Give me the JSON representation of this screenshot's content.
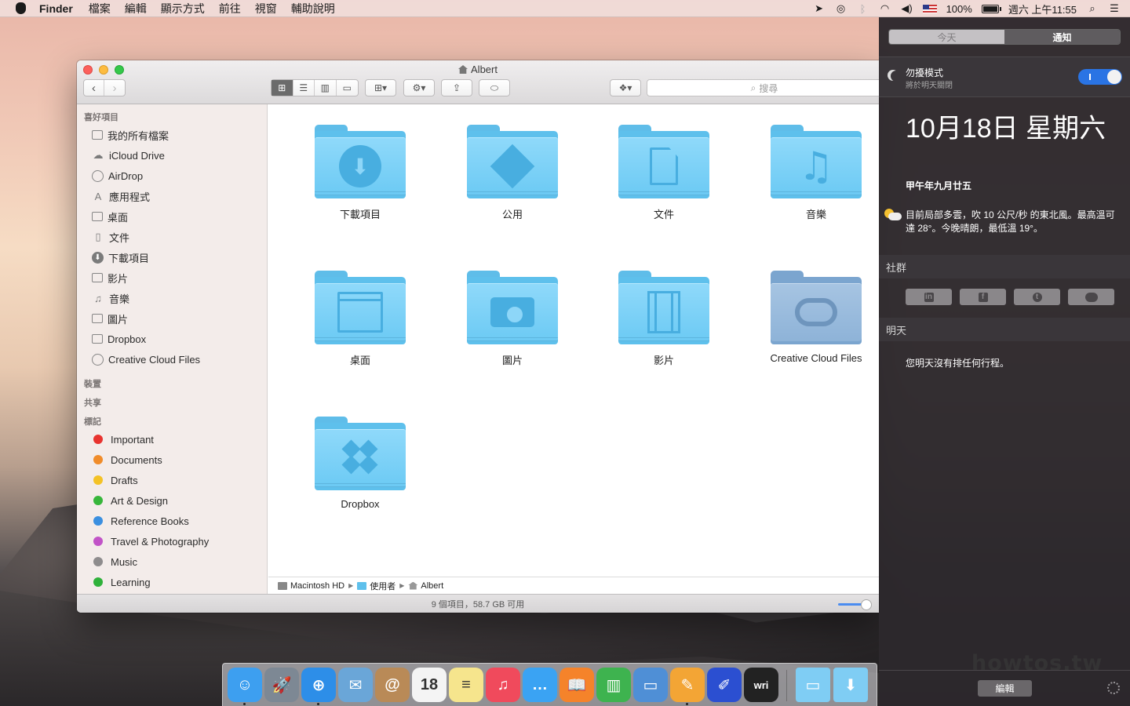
{
  "menubar": {
    "app_name": "Finder",
    "menus": [
      "檔案",
      "編輯",
      "顯示方式",
      "前往",
      "視窗",
      "輔助說明"
    ],
    "battery": "100%",
    "clock": "週六 上午11:55"
  },
  "finder": {
    "title": "Albert",
    "search_placeholder": "搜尋",
    "sidebar": {
      "favorites_header": "喜好項目",
      "favorites": [
        {
          "label": "我的所有檔案",
          "icon": "all-files-icon"
        },
        {
          "label": "iCloud Drive",
          "icon": "cloud-icon"
        },
        {
          "label": "AirDrop",
          "icon": "airdrop-icon"
        },
        {
          "label": "應用程式",
          "icon": "applications-icon"
        },
        {
          "label": "桌面",
          "icon": "desktop-icon"
        },
        {
          "label": "文件",
          "icon": "documents-icon"
        },
        {
          "label": "下載項目",
          "icon": "downloads-icon"
        },
        {
          "label": "影片",
          "icon": "movies-icon"
        },
        {
          "label": "音樂",
          "icon": "music-icon"
        },
        {
          "label": "圖片",
          "icon": "pictures-icon"
        },
        {
          "label": "Dropbox",
          "icon": "folder-icon"
        },
        {
          "label": "Creative Cloud Files",
          "icon": "creative-cloud-icon"
        }
      ],
      "devices_header": "裝置",
      "shared_header": "共享",
      "tags_header": "標記",
      "tags": [
        {
          "label": "Important",
          "color": "#e8332f"
        },
        {
          "label": "Documents",
          "color": "#f08c2a"
        },
        {
          "label": "Drafts",
          "color": "#f4c226"
        },
        {
          "label": "Art & Design",
          "color": "#37b63b"
        },
        {
          "label": "Reference Books",
          "color": "#3a8fe0"
        },
        {
          "label": "Travel & Photography",
          "color": "#c153c7"
        },
        {
          "label": "Music",
          "color": "#8e8c8d"
        },
        {
          "label": "Learning",
          "color": "#2fb13a"
        }
      ]
    },
    "folders": [
      {
        "label": "下載項目",
        "glyph": "download-icon"
      },
      {
        "label": "公用",
        "glyph": "public-icon"
      },
      {
        "label": "文件",
        "glyph": "document-icon"
      },
      {
        "label": "音樂",
        "glyph": "music-note-icon"
      },
      {
        "label": "桌面",
        "glyph": "desktop-window-icon"
      },
      {
        "label": "圖片",
        "glyph": "camera-icon"
      },
      {
        "label": "影片",
        "glyph": "film-icon"
      },
      {
        "label": "Creative Cloud Files",
        "glyph": "creative-cloud-icon"
      },
      {
        "label": "Dropbox",
        "glyph": "dropbox-icon"
      }
    ],
    "path": [
      "Macintosh HD",
      "使用者",
      "Albert"
    ],
    "status": "9 個項目，58.7 GB 可用"
  },
  "notification_center": {
    "tabs": [
      "今天",
      "通知"
    ],
    "active_tab": "今天",
    "dnd_title": "勿擾模式",
    "dnd_subtitle": "將於明天關閉",
    "dnd_enabled": true,
    "date": "10月18日 星期六",
    "lunar": "甲午年九月廿五",
    "weather": "目前局部多雲，吹 10 公尺/秒 的東北風。最高溫可達 28°。今晚晴朗，最低溫 19°。",
    "social_header": "社群",
    "social_buttons": [
      "in",
      "f",
      "t",
      "msg"
    ],
    "tomorrow_header": "明天",
    "tomorrow_text": "您明天沒有排任何行程。",
    "edit_label": "編輯"
  },
  "watermark": "howtos.tw",
  "dock": [
    {
      "name": "finder-dock-icon",
      "color": "#3d9ff0",
      "label": "☺"
    },
    {
      "name": "launchpad-dock-icon",
      "color": "#7d8894",
      "label": "🚀"
    },
    {
      "name": "safari-dock-icon",
      "color": "#2d8ee8",
      "label": "⊕"
    },
    {
      "name": "mail-dock-icon",
      "color": "#6aa6d8",
      "label": "✉"
    },
    {
      "name": "contacts-dock-icon",
      "color": "#b98a57",
      "label": "@"
    },
    {
      "name": "calendar-dock-icon",
      "color": "#f4f4f4",
      "label": "18"
    },
    {
      "name": "notes-dock-icon",
      "color": "#f6e58d",
      "label": "≡"
    },
    {
      "name": "itunes-dock-icon",
      "color": "#f04a5c",
      "label": "♫"
    },
    {
      "name": "messages-dock-icon",
      "color": "#3aa3f3",
      "label": "…"
    },
    {
      "name": "ibooks-dock-icon",
      "color": "#f5832a",
      "label": "📖"
    },
    {
      "name": "numbers-dock-icon",
      "color": "#3eb34f",
      "label": "▥"
    },
    {
      "name": "keynote-dock-icon",
      "color": "#4f8fd6",
      "label": "▭"
    },
    {
      "name": "pages-dock-icon",
      "color": "#f3a535",
      "label": "✎"
    },
    {
      "name": "sketch-dock-icon",
      "color": "#2b4fd1",
      "label": "✐"
    },
    {
      "name": "writer-dock-icon",
      "color": "#222222",
      "label": "wri"
    }
  ]
}
